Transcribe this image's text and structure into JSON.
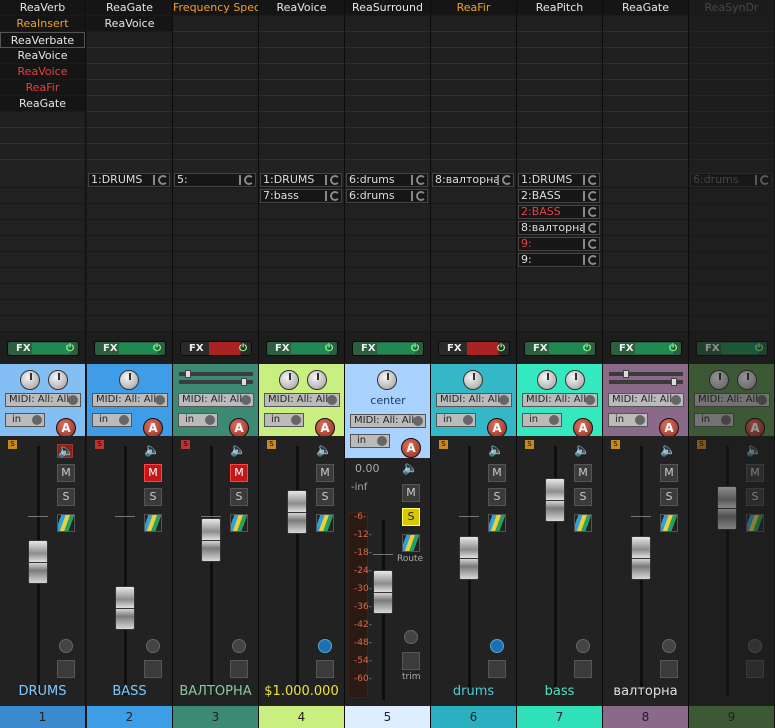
{
  "strips": [
    {
      "id": "1",
      "name": "DRUMS",
      "name_color": "#7fc8ff",
      "num_bg": "#3a8ad0",
      "header_bg": "#84bff3",
      "fx": [
        "ReaVerb",
        "ReaInsert",
        "ReaVerbate",
        "ReaVoice",
        "ReaVoice",
        "ReaFir",
        "ReaGate"
      ],
      "fx_styles": [
        "",
        "orange",
        "outlined",
        "",
        "red",
        "red",
        ""
      ],
      "sends": [],
      "fx_btn": "FX",
      "fader_pos": 0.47,
      "midi": "MIDI: All: All",
      "input": "in",
      "arm": "A"
    },
    {
      "id": "2",
      "name": "BASS",
      "name_color": "#7fc8ff",
      "num_bg": "#3d9ee6",
      "header_bg": "#3f9de8",
      "fx": [
        "ReaGate",
        "ReaVoice"
      ],
      "fx_styles": [
        "",
        ""
      ],
      "sends": [
        {
          "label": "1:DRUMS",
          "style": ""
        }
      ],
      "fx_btn": "FX",
      "fader_pos": 0.7,
      "midi": "MIDI: All: All",
      "input": "in",
      "arm": "A"
    },
    {
      "id": "3",
      "name": "ВАЛТОРНА",
      "name_color": "#8ac8a0",
      "num_bg": "#3c8a74",
      "header_bg": "#3c8a74",
      "fx": [
        "Frequency Spec"
      ],
      "fx_styles": [
        "orange"
      ],
      "sends": [
        {
          "label": "5:",
          "style": ""
        }
      ],
      "fx_btn": "FX",
      "fader_pos": 0.36,
      "midi": "MIDI: All: All",
      "input": "in",
      "arm": "A"
    },
    {
      "id": "4",
      "name": "$1.000.000",
      "name_color": "#f0e040",
      "num_bg": "#c8ef80",
      "header_bg": "#c8ef80",
      "fx": [
        "ReaVoice"
      ],
      "fx_styles": [
        ""
      ],
      "sends": [
        {
          "label": "1:DRUMS",
          "style": ""
        },
        {
          "label": "7:bass",
          "style": ""
        }
      ],
      "fx_btn": "FX",
      "fader_pos": 0.22,
      "midi": "MIDI: All: All",
      "input": "in",
      "arm": "A"
    },
    {
      "id": "5",
      "name": "",
      "name_color": "#cfcfcf",
      "num_bg": "#dfeeff",
      "header_bg": "#a9d2ff",
      "fx": [
        "ReaSurround"
      ],
      "fx_styles": [
        ""
      ],
      "sends": [
        {
          "label": "6:drums",
          "style": ""
        },
        {
          "label": "6:drums",
          "style": ""
        }
      ],
      "fx_btn": "FX",
      "fader_pos": 0.33,
      "midi": "MIDI: All: All",
      "input": "in",
      "arm": "A"
    },
    {
      "id": "6",
      "name": "drums",
      "name_color": "#54c8d8",
      "num_bg": "#2ab0c0",
      "header_bg": "#34b8c8",
      "fx": [
        "ReaFir"
      ],
      "fx_styles": [
        "orange"
      ],
      "sends": [
        {
          "label": "8:валторна",
          "style": ""
        }
      ],
      "fx_btn": "FX",
      "fader_pos": 0.45,
      "midi": "MIDI: All: All",
      "input": "in",
      "arm": "A"
    },
    {
      "id": "7",
      "name": "bass",
      "name_color": "#54e0c0",
      "num_bg": "#30e0b8",
      "header_bg": "#34e8c0",
      "fx": [
        "ReaPitch"
      ],
      "fx_styles": [
        ""
      ],
      "sends": [
        {
          "label": "1:DRUMS",
          "style": ""
        },
        {
          "label": "2:BASS",
          "style": ""
        },
        {
          "label": "2:BASS",
          "style": "red"
        },
        {
          "label": "8:валторна",
          "style": ""
        },
        {
          "label": "9:",
          "style": "red"
        },
        {
          "label": "9:",
          "style": ""
        }
      ],
      "fx_btn": "FX",
      "fader_pos": 0.16,
      "midi": "MIDI: All: All",
      "input": "in",
      "arm": "A"
    },
    {
      "id": "8",
      "name": "валторна",
      "name_color": "#e0e0e0",
      "num_bg": "#8a6a88",
      "header_bg": "#8a6a88",
      "fx": [
        "ReaGate"
      ],
      "fx_styles": [
        ""
      ],
      "sends": [],
      "fx_btn": "FX",
      "fader_pos": 0.45,
      "midi": "MIDI: All: All",
      "input": "in",
      "arm": "A"
    },
    {
      "id": "9",
      "name": "",
      "name_color": "#777",
      "num_bg": "#5a8a4a",
      "header_bg": "#5a8a4a",
      "fx": [
        "ReaSynDr"
      ],
      "fx_styles": [
        "grey"
      ],
      "sends": [
        {
          "label": "6:drums",
          "style": "grey"
        }
      ],
      "fx_btn": "FX",
      "fader_pos": 0.2,
      "midi": "MIDI: All: All",
      "input": "in",
      "arm": "A"
    }
  ],
  "master": {
    "pan_label": "center",
    "volume": "0.00",
    "peak": "-inf",
    "route": "Route",
    "trim": "trim",
    "scale": [
      "-6-",
      "-12-",
      "-18-",
      "-24-",
      "-30-",
      "-36-",
      "-42-",
      "-48-",
      "-54-",
      "-60-"
    ]
  },
  "buttons": {
    "mute": "M",
    "solo": "S",
    "speaker": "🔈",
    "ss_label": "S"
  }
}
